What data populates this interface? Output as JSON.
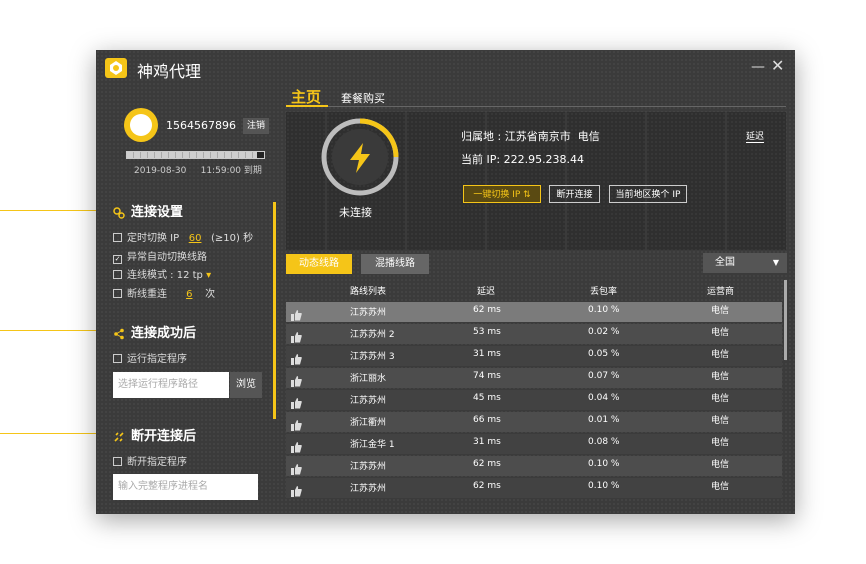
{
  "app": {
    "title": "神鸡代理"
  },
  "user": {
    "id": "1564567896",
    "logout_label": "注销",
    "expire_text": "2019-08-30     11:59:00 到期",
    "progress": 0.95
  },
  "connect_settings": {
    "title": "连接设置",
    "timed_switch_prefix": "定时切换 IP",
    "timed_switch_value": "60",
    "timed_switch_suffix": "(≥10) 秒",
    "auto_switch_label": "异常自动切换线路",
    "line_mode_label": "连线模式 : 12 tp",
    "reconnect_prefix": "断线重连",
    "reconnect_value": "6",
    "reconnect_suffix": "次"
  },
  "after_connect": {
    "title": "连接成功后",
    "run_program_label": "运行指定程序",
    "program_path_placeholder": "选择运行程序路径",
    "browse_label": "浏览"
  },
  "after_disconnect": {
    "title": "断开连接后",
    "stop_program_label": "断开指定程序",
    "process_name_placeholder": "输入完整程序进程名"
  },
  "tabs": {
    "main": "主页",
    "buy": "套餐购买"
  },
  "status": {
    "state_label": "未连接",
    "location_text": "归属地 : 江苏省南京市  电信",
    "ip_text": "当前 IP: 222.95.238.44",
    "delay_link": "延迟",
    "switch_ip_button": "一键切换 IP ⇅",
    "disconnect_button": "断开连接",
    "switch_region_button": "当前地区换个 IP"
  },
  "line_tabs": {
    "dynamic": "动态线路",
    "mixed": "混播线路"
  },
  "region_select": {
    "value": "全国"
  },
  "table": {
    "headers": [
      "路线列表",
      "延迟",
      "丢包率",
      "运营商"
    ],
    "rows": [
      {
        "route": "江苏苏州",
        "delay": "62 ms",
        "loss": "0.10 %",
        "isp": "电信"
      },
      {
        "route": "江苏苏州 2",
        "delay": "53 ms",
        "loss": "0.02 %",
        "isp": "电信"
      },
      {
        "route": "江苏苏州 3",
        "delay": "31 ms",
        "loss": "0.05 %",
        "isp": "电信"
      },
      {
        "route": "浙江丽水",
        "delay": "74 ms",
        "loss": "0.07 %",
        "isp": "电信"
      },
      {
        "route": "江苏苏州",
        "delay": "45 ms",
        "loss": "0.04 %",
        "isp": "电信"
      },
      {
        "route": "浙江衢州",
        "delay": "66 ms",
        "loss": "0.01 %",
        "isp": "电信"
      },
      {
        "route": "浙江金华 1",
        "delay": "31 ms",
        "loss": "0.08 %",
        "isp": "电信"
      },
      {
        "route": "江苏苏州",
        "delay": "62 ms",
        "loss": "0.10 %",
        "isp": "电信"
      },
      {
        "route": "江苏苏州",
        "delay": "62 ms",
        "loss": "0.10 %",
        "isp": "电信"
      }
    ]
  },
  "colors": {
    "accent": "#f5c518",
    "window_bg": "#3b3b3b",
    "row_selected": "#7b7b7b",
    "row_alt": "#4d4d4d",
    "row_base": "#424242"
  }
}
